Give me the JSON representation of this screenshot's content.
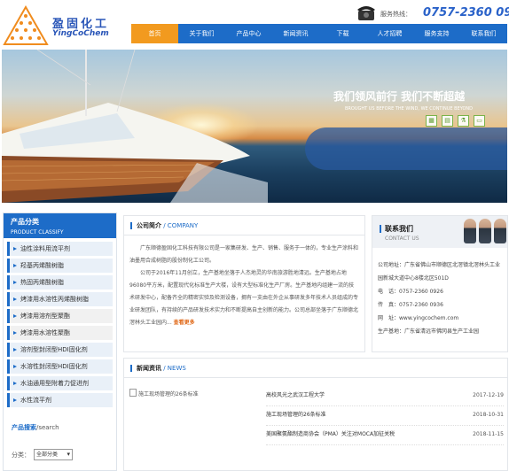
{
  "header": {
    "logo_cn": "盈固化工",
    "logo_en": "YingCoChem",
    "hotline_label": "服务热线：",
    "hotline_number": "0757-2360 0926"
  },
  "nav": {
    "items": [
      "首页",
      "关于我们",
      "产品中心",
      "新闻资讯",
      "下载",
      "人才招聘",
      "服务支持",
      "联系我们"
    ],
    "active_index": 0
  },
  "banner": {
    "slogan_cn": "我们领风前行  我们不断超越",
    "slogan_en": "BROUGHT US BEFORE THE WIND, WE CONTINUE BEYOND",
    "slide_count": 3,
    "active_slide": 1
  },
  "sidebar": {
    "title_cn": "产品分类",
    "title_en": "PRODUCT CLASSIFY",
    "items": [
      "油性涂料用流平剂",
      "羟基丙烯酸树脂",
      "热固丙烯酸树脂",
      "烤漆用水溶性丙烯酸树脂",
      "烤漆用溶剂型聚酯",
      "烤漆用水溶性聚酯",
      "溶剂型封闭型HDI固化剂",
      "水溶性封闭型HDI固化剂",
      "水油通用型附着力促进剂",
      "水性流平剂"
    ],
    "highlighted_indices": [
      4,
      5
    ],
    "search_title": "产品搜索",
    "search_title_en": "/search",
    "search_label": "分类：",
    "search_select_value": "全部分类"
  },
  "company": {
    "title_cn": "公司简介",
    "title_en": " / COMPANY",
    "para1": "广东顺德盈固化工科技有限公司是一家集研发、生产、销售、服务于一体的，专业生产涂料和油墨用合成树脂的股份制化工公司。",
    "para2": "公司于2016年11月创立，生产基地坐落于人杰地灵的华南旅游胜地清远。生产基地占地96080平方米，配置现代化标准生产大楼，设有大型标准化生产厂房。生产基地内组建一流的技术研发中心，配备齐全的精密实验及检测设备，拥有一支由在外企从事研发多年技术人员组成的专业研发团队，有持续的产品研发技术实力和不断提高自主创新的能力。公司总部坐落于广东顺德北滘林头工业园内...",
    "more_label": "查看更多"
  },
  "contact": {
    "title_cn": "联系我们",
    "title_en": "CONTACT US",
    "lines": [
      "公司地址：广东省佛山市顺德区北滘镇北滘林头工业园新城大道中心8楼北区501D",
      "电　话：0757-2360 0926",
      "传　真：0757-2360 0936",
      "网　址：www.yingcochem.com",
      "生产基地：广东省清远市佛冈县生产工业园"
    ]
  },
  "news": {
    "title_cn": "新闻资讯",
    "title_en": " / NEWS",
    "image_alt": "施工现场管理的26条标准",
    "items": [
      {
        "title": "高校风光之武汉工程大学",
        "date": "2017-12-19"
      },
      {
        "title": "施工现场管理的26条标准",
        "date": "2018-10-31"
      },
      {
        "title": "美国聚氨酯制造商协会（PMA）关注对MOCA加征关税",
        "date": "2018-11-15"
      }
    ]
  }
}
